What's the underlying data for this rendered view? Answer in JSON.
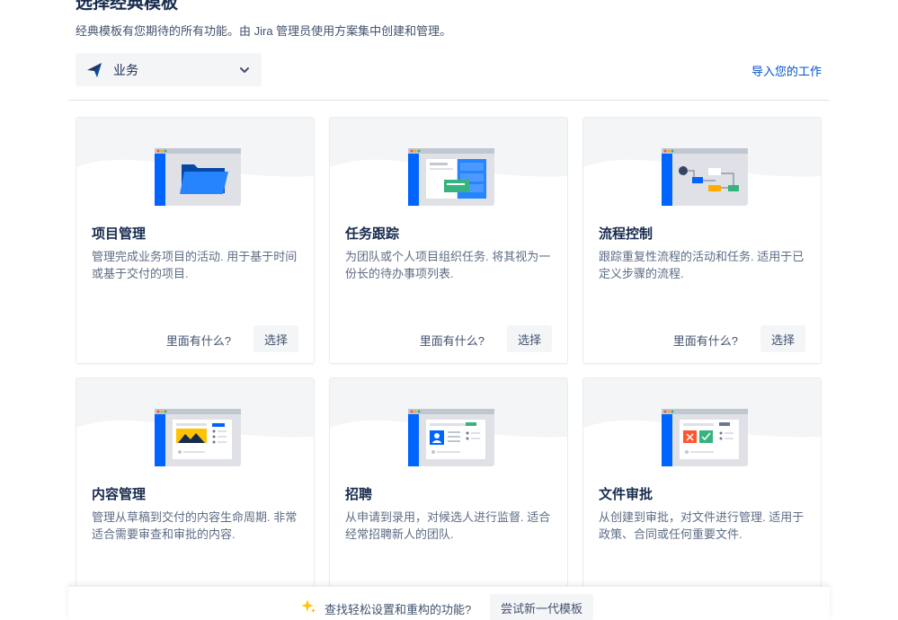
{
  "header": {
    "title": "选择经典模板",
    "subtitle": "经典模板有您期待的所有功能。由 Jira 管理员使用方案集中创建和管理。"
  },
  "type_select": {
    "selected": "业务",
    "icon": "business-icon"
  },
  "import_link": "导入您的工作",
  "cards": [
    {
      "title": "项目管理",
      "desc": "管理完成业务项目的活动. 用于基于时间或基于交付的项目.",
      "more": "里面有什么?",
      "choose": "选择",
      "illustration": "folder-icon"
    },
    {
      "title": "任务跟踪",
      "desc": "为团队或个人项目组织任务. 将其视为一份长的待办事项列表.",
      "more": "里面有什么?",
      "choose": "选择",
      "illustration": "task-list-icon"
    },
    {
      "title": "流程控制",
      "desc": "跟踪重复性流程的活动和任务. 适用于已定义步骤的流程.",
      "more": "里面有什么?",
      "choose": "选择",
      "illustration": "workflow-icon"
    },
    {
      "title": "内容管理",
      "desc": "管理从草稿到交付的内容生命周期. 非常适合需要审查和审批的内容.",
      "more": "",
      "choose": "",
      "illustration": "content-icon"
    },
    {
      "title": "招聘",
      "desc": "从申请到录用，对候选人进行监督. 适合经常招聘新人的团队.",
      "more": "",
      "choose": "",
      "illustration": "recruiting-icon"
    },
    {
      "title": "文件审批",
      "desc": "从创建到审批，对文件进行管理. 适用于政策、合同或任何重要文件.",
      "more": "",
      "choose": "",
      "illustration": "document-approval-icon"
    }
  ],
  "bottom_bar": {
    "question": "查找轻松设置和重构的功能?",
    "try_button": "尝试新一代模板",
    "icon": "sparkle-icon"
  },
  "colors": {
    "accent": "#0052cc",
    "blue_bar": "#0065ff",
    "card_hero_bg": "#f4f5f7",
    "text_primary": "#172b4d",
    "text_secondary": "#5e6c84"
  }
}
